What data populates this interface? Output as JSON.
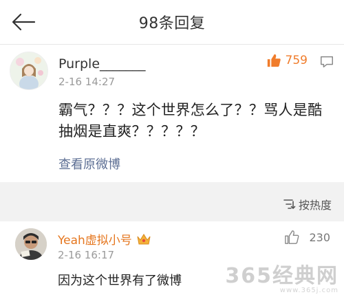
{
  "header": {
    "title": "98条回复",
    "back_icon": "back-arrow-icon"
  },
  "main_comment": {
    "username": "Purple_______",
    "timestamp": "2-16 14:27",
    "like_count": "759",
    "like_icon": "thumbs-up-icon",
    "reply_icon": "comment-icon",
    "text": "霸气？？？这个世界怎么了？？骂人是酷抽烟是直爽？？？？？",
    "view_original": "查看原微博"
  },
  "sort": {
    "label": "按热度",
    "icon": "sort-icon"
  },
  "second_comment": {
    "username": "Yeah虚拟小号",
    "badge_icon": "crown-badge-icon",
    "timestamp": "2-16 16:17",
    "like_count": "230",
    "like_icon": "thumbs-up-outline-icon",
    "text": "因为这个世界有了微博"
  },
  "watermark": {
    "main": "365经典网",
    "sub": "www.365j.com"
  },
  "colors": {
    "accent": "#f07c2b",
    "link": "#5d6f94",
    "username_vip": "#e5761e",
    "divider": "#f2f2f2"
  }
}
